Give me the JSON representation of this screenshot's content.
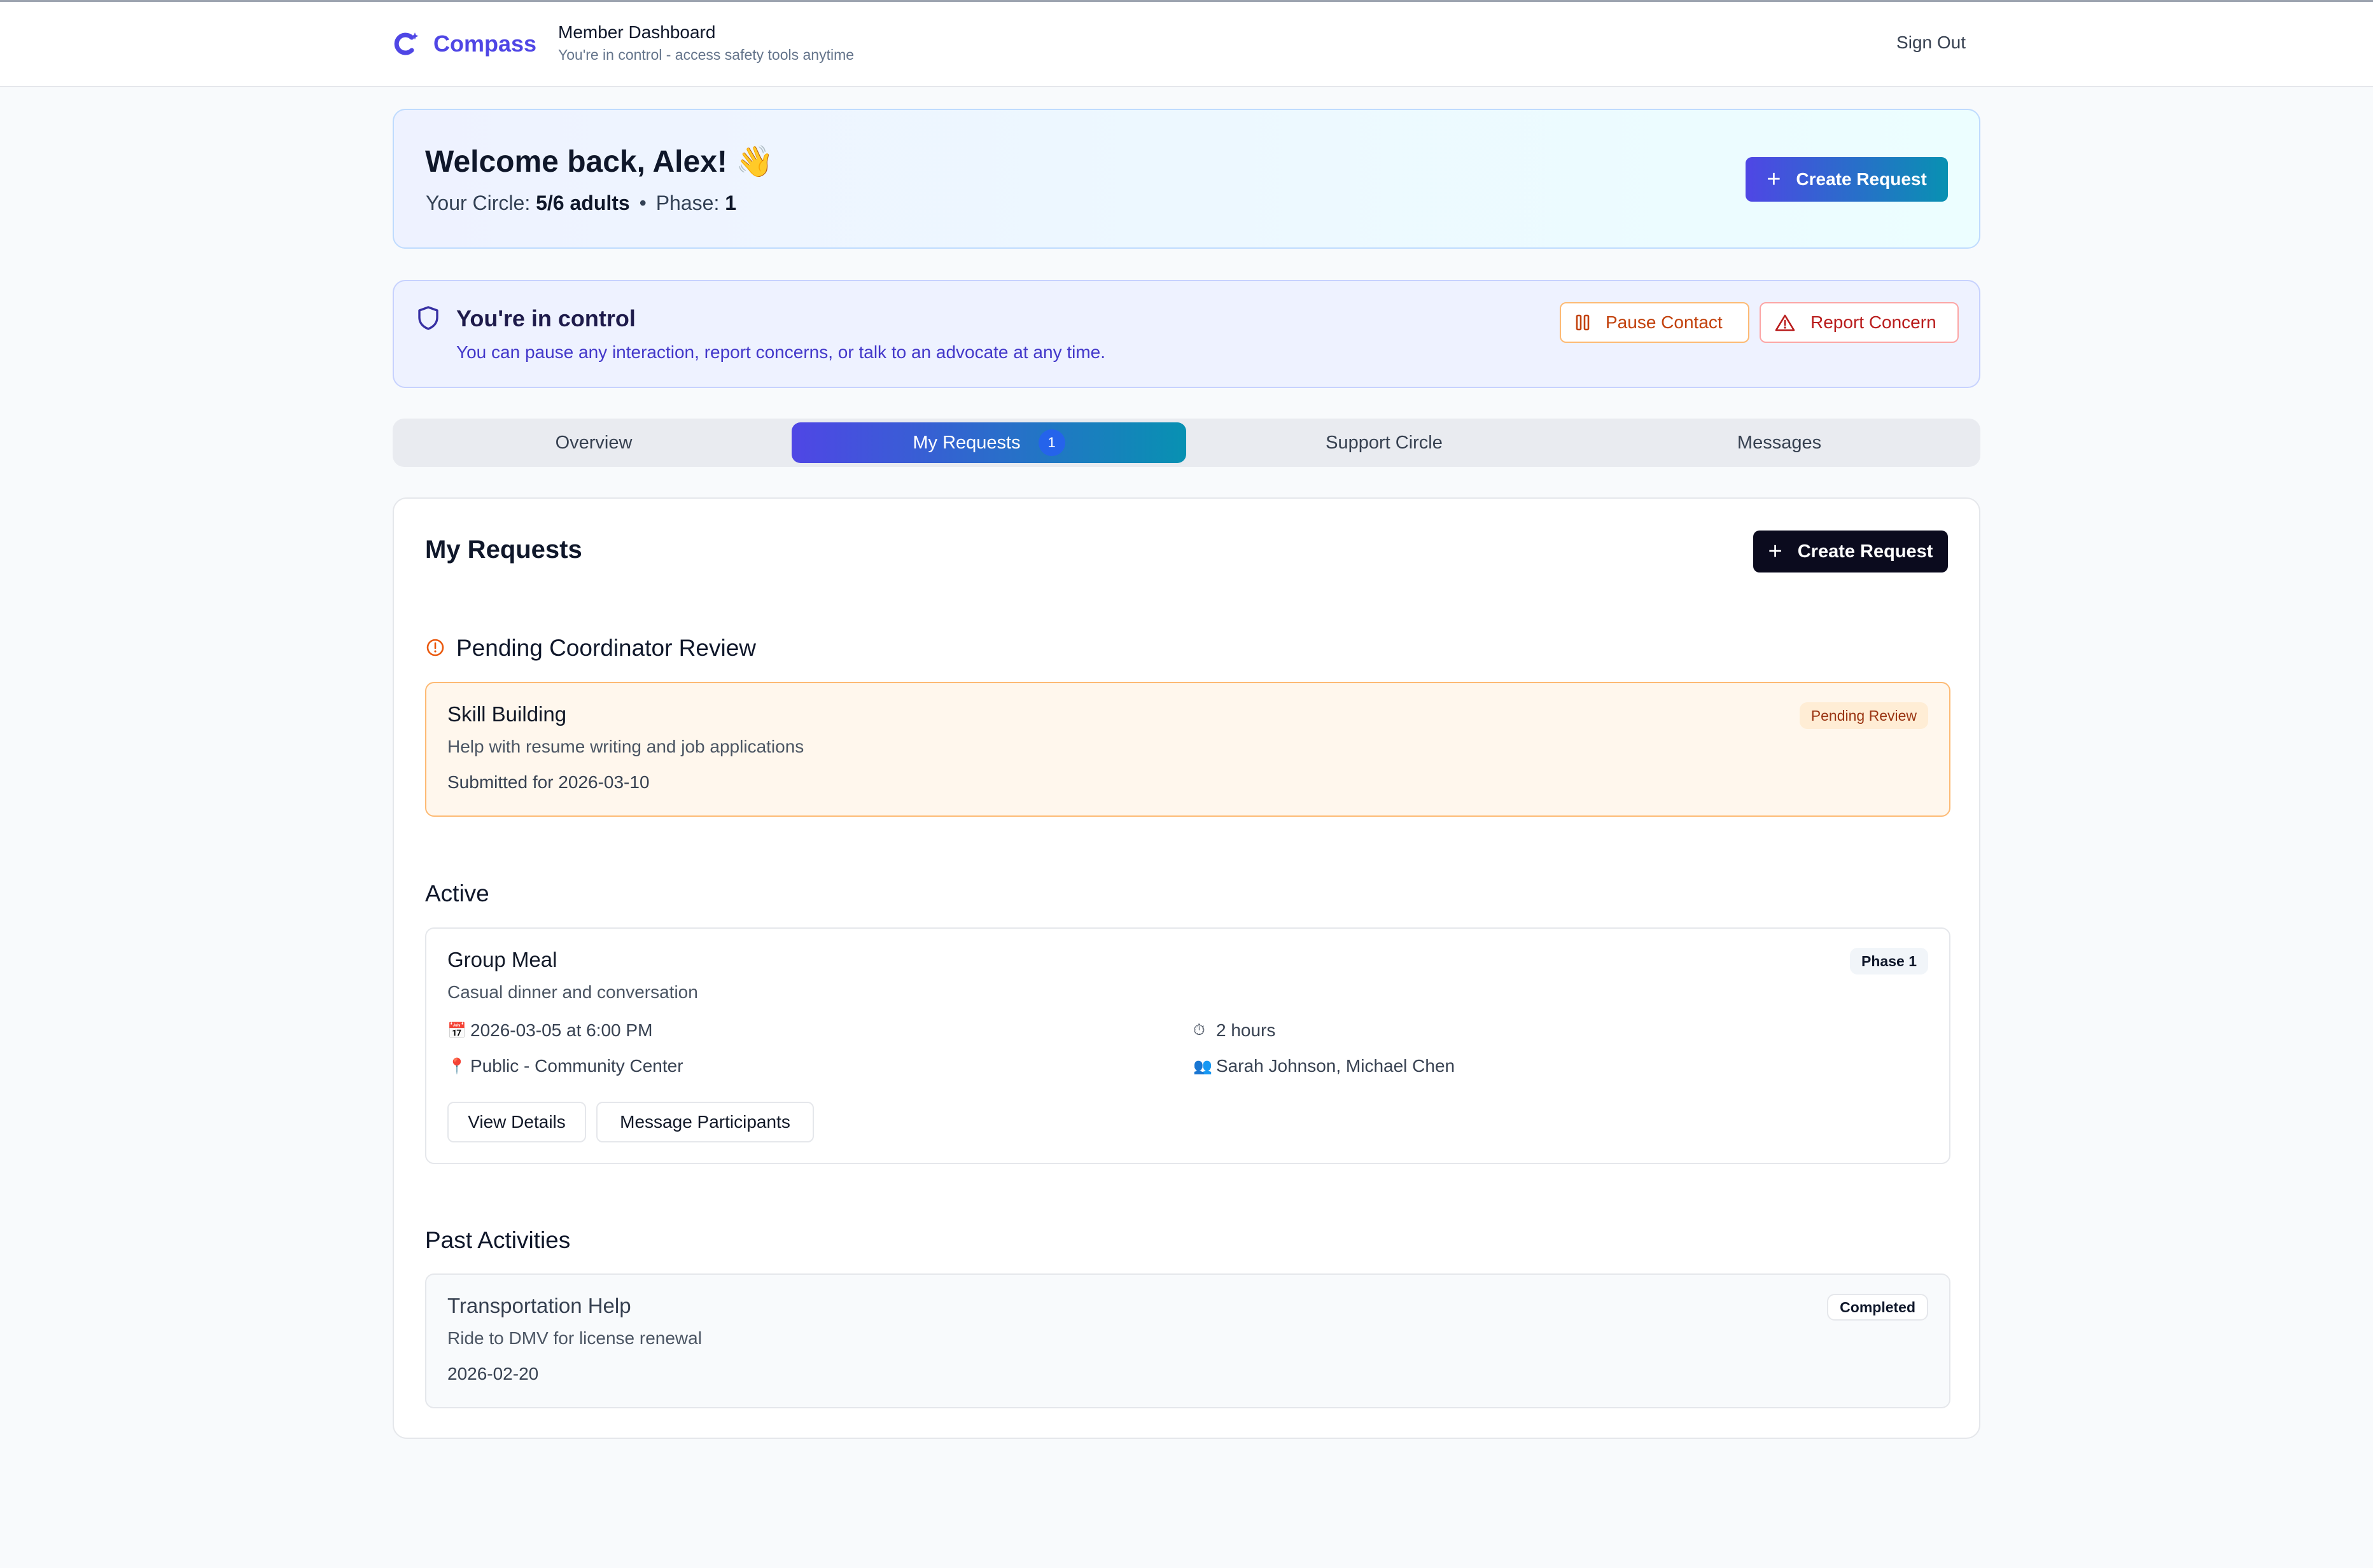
{
  "header": {
    "brand": "Compass",
    "title": "Member Dashboard",
    "subtitle": "You're in control - access safety tools anytime",
    "sign_out": "Sign Out"
  },
  "welcome": {
    "title": "Welcome back, Alex! 👋",
    "circle_label": "Your Circle:",
    "circle_value": "5/6 adults",
    "separator": "•",
    "phase_label": "Phase:",
    "phase_value": "1",
    "create_button": "Create Request"
  },
  "control": {
    "title": "You're in control",
    "subtitle": "You can pause any interaction, report concerns, or talk to an advocate at any time.",
    "pause_button": "Pause Contact",
    "report_button": "Report Concern"
  },
  "tabs": [
    {
      "label": "Overview",
      "active": false
    },
    {
      "label": "My Requests",
      "active": true,
      "badge": "1"
    },
    {
      "label": "Support Circle",
      "active": false
    },
    {
      "label": "Messages",
      "active": false
    }
  ],
  "requests": {
    "title": "My Requests",
    "create_button": "Create Request",
    "pending": {
      "section_title": "Pending Coordinator Review",
      "card": {
        "title": "Skill Building",
        "description": "Help with resume writing and job applications",
        "meta": "Submitted for 2026-03-10",
        "badge": "Pending Review"
      }
    },
    "active": {
      "section_title": "Active",
      "card": {
        "title": "Group Meal",
        "description": "Casual dinner and conversation",
        "badge": "Phase 1",
        "datetime": "2026-03-05 at 6:00 PM",
        "duration": "2 hours",
        "location": "Public - Community Center",
        "participants": "Sarah Johnson, Michael Chen",
        "view_button": "View Details",
        "message_button": "Message Participants"
      }
    },
    "past": {
      "section_title": "Past Activities",
      "card": {
        "title": "Transportation Help",
        "description": "Ride to DMV for license renewal",
        "meta": "2026-02-20",
        "badge": "Completed"
      }
    }
  },
  "icons": {
    "calendar": "calendar-icon",
    "stopwatch": "stopwatch-icon",
    "pin": "map-pin-icon",
    "people": "people-icon"
  },
  "colors": {
    "brand": "#4f46e5",
    "accent_end": "#0891b2",
    "pause": "#c2410c",
    "report": "#b91c1c",
    "pending_bg": "#fff7ed"
  }
}
